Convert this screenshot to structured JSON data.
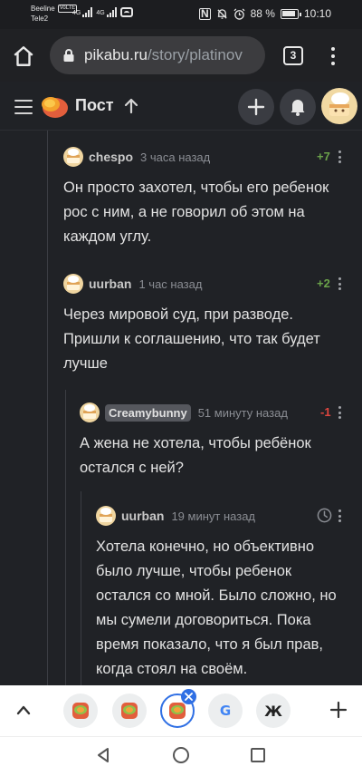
{
  "status_bar": {
    "carrier1": "Beeline",
    "carrier1_badge": "VoLTE",
    "carrier2": "Tele2",
    "network1": "4G",
    "network2": "4G",
    "battery": "88 %",
    "time": "10:10"
  },
  "browser": {
    "url_host": "pikabu.ru",
    "url_path": "/story/platinov",
    "tab_count": "3"
  },
  "site_header": {
    "title": "Пост"
  },
  "comments": [
    {
      "author": "chespo",
      "time": "3 часа назад",
      "rating": "+7",
      "text": "Он просто захотел, чтобы его ребенок рос с ним, а не говорил об этом на каждом углу."
    },
    {
      "author": "uurban",
      "time": "1 час назад",
      "rating": "+2",
      "text": "Через мировой суд, при разводе. Пришли к соглашению, что так будет лучше"
    },
    {
      "author": "Creamybunny",
      "time": "51 минуту назад",
      "rating": "-1",
      "text": "А жена не хотела, чтобы ребёнок остался с ней?"
    },
    {
      "author": "uurban",
      "time": "19 минут назад",
      "rating": "",
      "text": "Хотела конечно, но объективно было лучше, чтобы ребенок остался со мной. Было сложно, но мы сумели договориться. Пока время показало, что я был прав, когда стоял на своём."
    }
  ],
  "tab_strip": {
    "tab_google": "G",
    "tab_zh": "Ж"
  },
  "colors": {
    "background": "#202226",
    "positive": "#6ba34a",
    "negative": "#e0463f",
    "accent": "#2f6fe4"
  }
}
